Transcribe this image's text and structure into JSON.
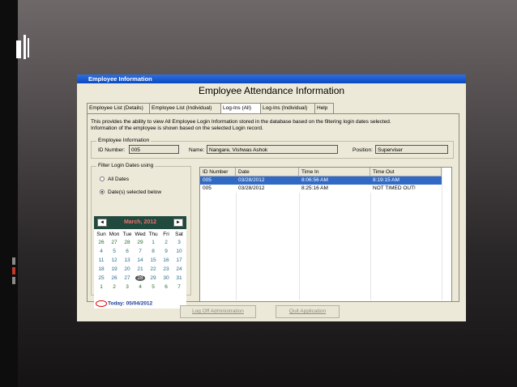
{
  "window": {
    "title": "Employee Information",
    "heading": "Employee Attendance Information"
  },
  "tabs": [
    {
      "label": "Employee List (Details)"
    },
    {
      "label": "Employee List (Individual)"
    },
    {
      "label": "Log-Ins (All)"
    },
    {
      "label": "Log-Ins (Individual)"
    },
    {
      "label": "Help"
    }
  ],
  "description": {
    "line1": "This provides the ability to view All Employee Login Information stored in the database based on the filtering login dates selected.",
    "line2": "Information of the employee is shown based on the selected Login record."
  },
  "employee_info": {
    "group_label": "Employee Information",
    "id_label": "ID Number:",
    "id_value": "005",
    "name_label": "Name:",
    "name_value": "Nangare, Vishwas Ashok",
    "position_label": "Position:",
    "position_value": "Superviser"
  },
  "filter": {
    "group_label": "Filter Login Dates using",
    "option_all": "All Dates",
    "option_selected": "Date(s) selected below"
  },
  "calendar": {
    "month_label": "March, 2012",
    "prev_glyph": "◄",
    "next_glyph": "►",
    "weekdays": [
      "Sun",
      "Mon",
      "Tue",
      "Wed",
      "Thu",
      "Fri",
      "Sat"
    ],
    "weeks": [
      [
        "26",
        "27",
        "28",
        "29",
        "1",
        "2",
        "3"
      ],
      [
        "4",
        "5",
        "6",
        "7",
        "8",
        "9",
        "10"
      ],
      [
        "11",
        "12",
        "13",
        "14",
        "15",
        "16",
        "17"
      ],
      [
        "18",
        "19",
        "20",
        "21",
        "22",
        "23",
        "24"
      ],
      [
        "25",
        "26",
        "27",
        "28",
        "29",
        "30",
        "31"
      ],
      [
        "1",
        "2",
        "3",
        "4",
        "5",
        "6",
        "7"
      ]
    ],
    "today_label": "Today: 05/04/2012"
  },
  "table": {
    "columns": [
      "ID Number",
      "Date",
      "Time In",
      "Time Out"
    ],
    "rows": [
      {
        "id": "005",
        "date": "03/28/2012",
        "time_in": "8:06:56 AM",
        "time_out": "8:19:15 AM"
      },
      {
        "id": "005",
        "date": "03/28/2012",
        "time_in": "8:25:16 AM",
        "time_out": "NOT TIMED OUT!"
      }
    ]
  },
  "buttons": {
    "logoff": "Log Off Administration",
    "quit": "Quit Application"
  }
}
